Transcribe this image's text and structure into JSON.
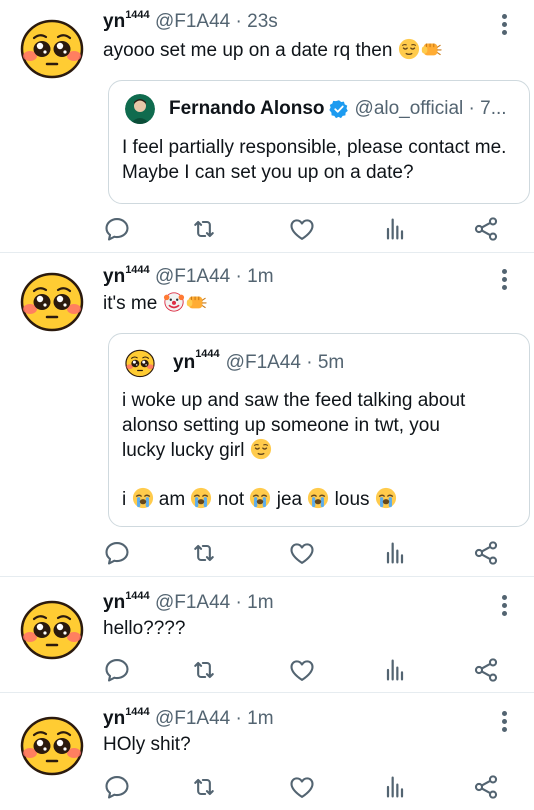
{
  "tweets": [
    {
      "author": "yn",
      "author_sup": "1444",
      "handle": "@F1A44",
      "time": "· 23s",
      "text": "ayooo set me up on a date rq then",
      "quote": {
        "author": "Fernando Alonso",
        "handle": "@alo_official · 7...",
        "text": "I feel partially responsible, please contact me. Maybe I can set you up on a date?"
      }
    },
    {
      "author": "yn",
      "author_sup": "1444",
      "handle": "@F1A44",
      "time": "· 1m",
      "text": "it's me",
      "quote": {
        "author": "yn",
        "author_sup": "1444",
        "handle": "@F1A44 · 5m",
        "text_line1": "i woke up and saw the feed talking about",
        "text_line2": "alonso setting up someone in twt, you",
        "text_line3": "lucky lucky girl",
        "words": [
          "i",
          "am",
          "not",
          "jea",
          "lous"
        ]
      }
    },
    {
      "author": "yn",
      "author_sup": "1444",
      "handle": "@F1A44",
      "time": "· 1m",
      "text": "hello????"
    },
    {
      "author": "yn",
      "author_sup": "1444",
      "handle": "@F1A44",
      "time": "· 1m",
      "text": "HOly shit?"
    }
  ],
  "icons": {
    "reply": "reply-icon",
    "retweet": "retweet-icon",
    "like": "heart-icon",
    "analytics": "analytics-icon",
    "share": "share-icon"
  },
  "colors": {
    "icon": "#536471",
    "verified": "#1d9bf0",
    "border": "#cfd9de",
    "divider": "#e6ecf0"
  }
}
